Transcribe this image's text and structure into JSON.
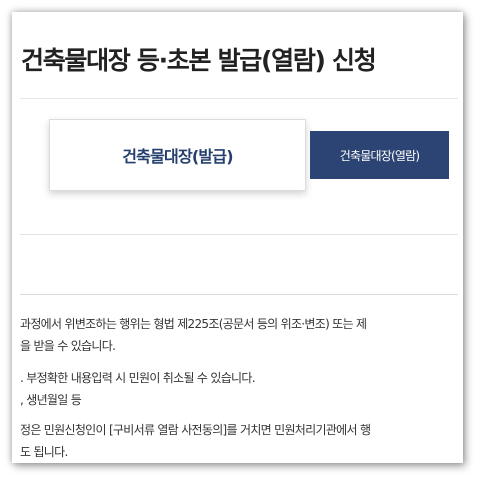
{
  "page": {
    "title": "건축물대장 등·초본 발급(열람) 신청"
  },
  "tabs": [
    {
      "label": "건축물대장(발급)",
      "active": true
    },
    {
      "label": "건축물대장(열람)",
      "active": false
    }
  ],
  "notice": {
    "lines": [
      " 과정에서 위변조하는 행위는 형법 제225조(공문서 등의 위조·변조) 또는 제",
      "을 받을 수 있습니다.",
      ". 부정확한 내용입력 시 민원이 취소될 수 있습니다.",
      ", 생년월일 등",
      "정은 민원신청인이 [구비서류 열람 사전동의]를 거치면 민원처리기관에서 행",
      "도 됩니다."
    ]
  },
  "colors": {
    "tab_active_text": "#243f6e",
    "tab_inactive_bg": "#2b4474",
    "tab_inactive_text": "#ffffff",
    "title_text": "#222222",
    "body_text": "#333333"
  }
}
